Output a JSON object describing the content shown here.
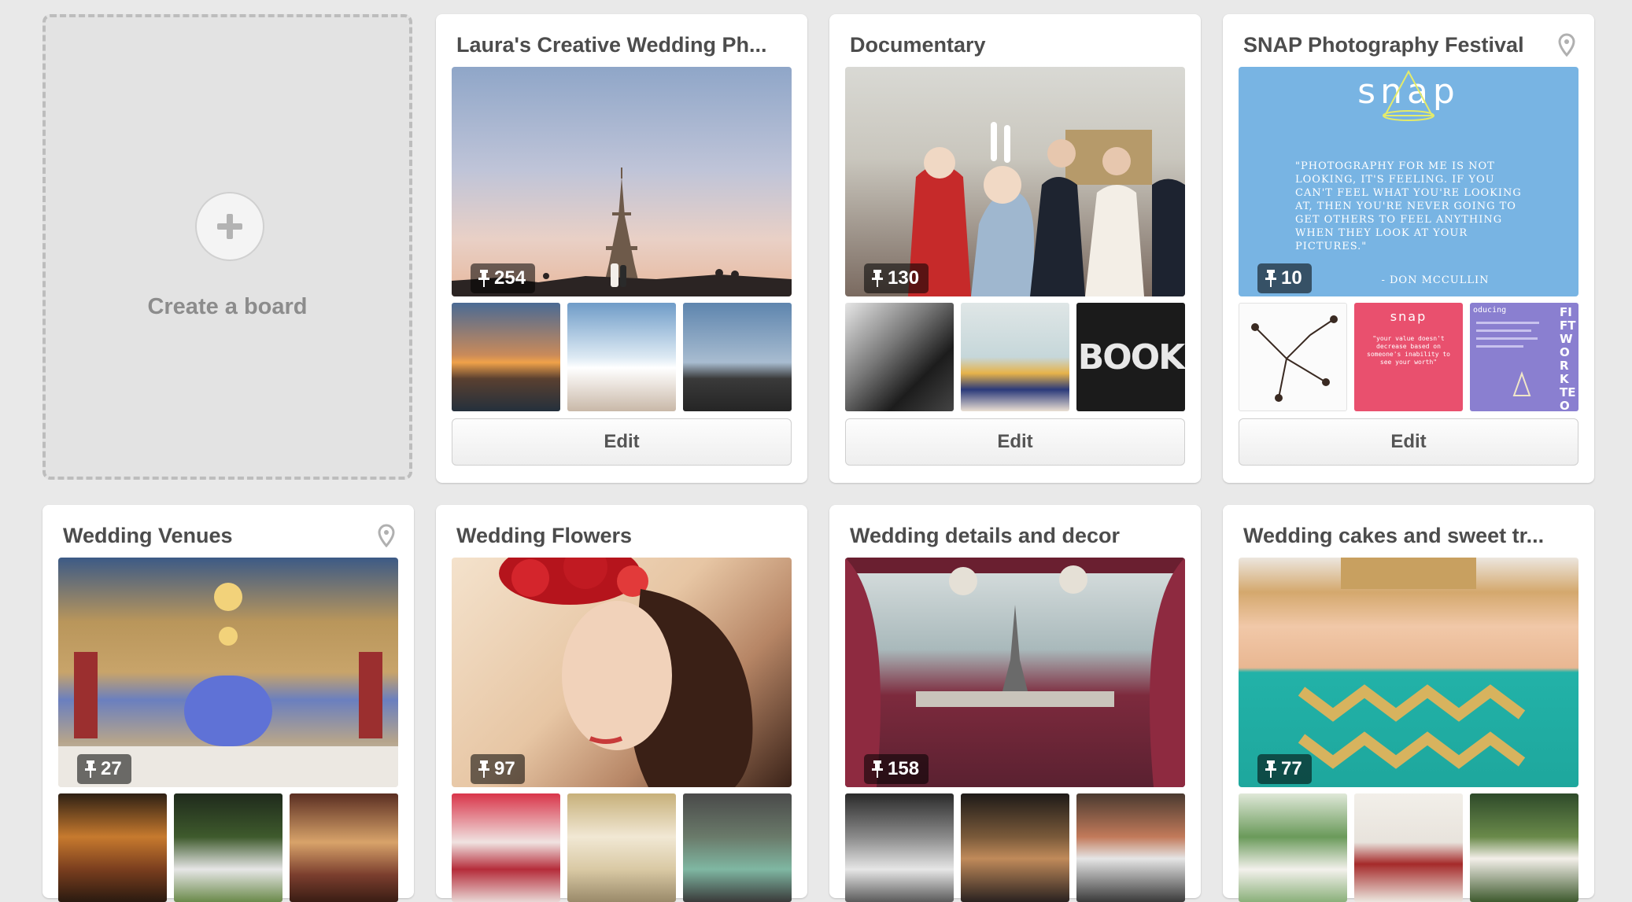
{
  "create_board": {
    "label": "Create a board"
  },
  "boards": [
    {
      "title": "Laura's Creative Wedding Ph...",
      "pin_count": "254",
      "has_location": false,
      "edit_label": "Edit"
    },
    {
      "title": "Documentary",
      "pin_count": "130",
      "has_location": false,
      "edit_label": "Edit"
    },
    {
      "title": "SNAP Photography Festival",
      "pin_count": "10",
      "has_location": true,
      "edit_label": "Edit",
      "cover_text": {
        "logo": "snap",
        "quote": "\"Photography for me is not looking, it's feeling. If you can't feel what you're looking at, then you're never going to get others to feel anything when they look at your pictures.\"",
        "author": "- Don McCullin"
      },
      "thumb_texts": {
        "pink_logo": "snap",
        "pink_quote": "\"your value doesn't decrease based on someone's inability to see your worth\"",
        "purple_title": "oducing",
        "side_text": "FIFT WORK TE ON MON PAR",
        "book_sign": "BOOK"
      }
    },
    {
      "title": "Wedding Venues",
      "pin_count": "27",
      "has_location": true
    },
    {
      "title": "Wedding Flowers",
      "pin_count": "97",
      "has_location": false
    },
    {
      "title": "Wedding details and decor",
      "pin_count": "158",
      "has_location": false
    },
    {
      "title": "Wedding cakes and sweet tr...",
      "pin_count": "77",
      "has_location": false
    }
  ],
  "colors": {
    "page_background": "#e9e9e9",
    "card_background": "#ffffff",
    "title_text": "#4c4c4c",
    "snap_blue": "#78b4e3",
    "snap_pink": "#e9506e",
    "snap_purple": "#8a7fd0"
  },
  "icons": [
    "plus-icon",
    "pin-icon",
    "location-marker-icon"
  ]
}
